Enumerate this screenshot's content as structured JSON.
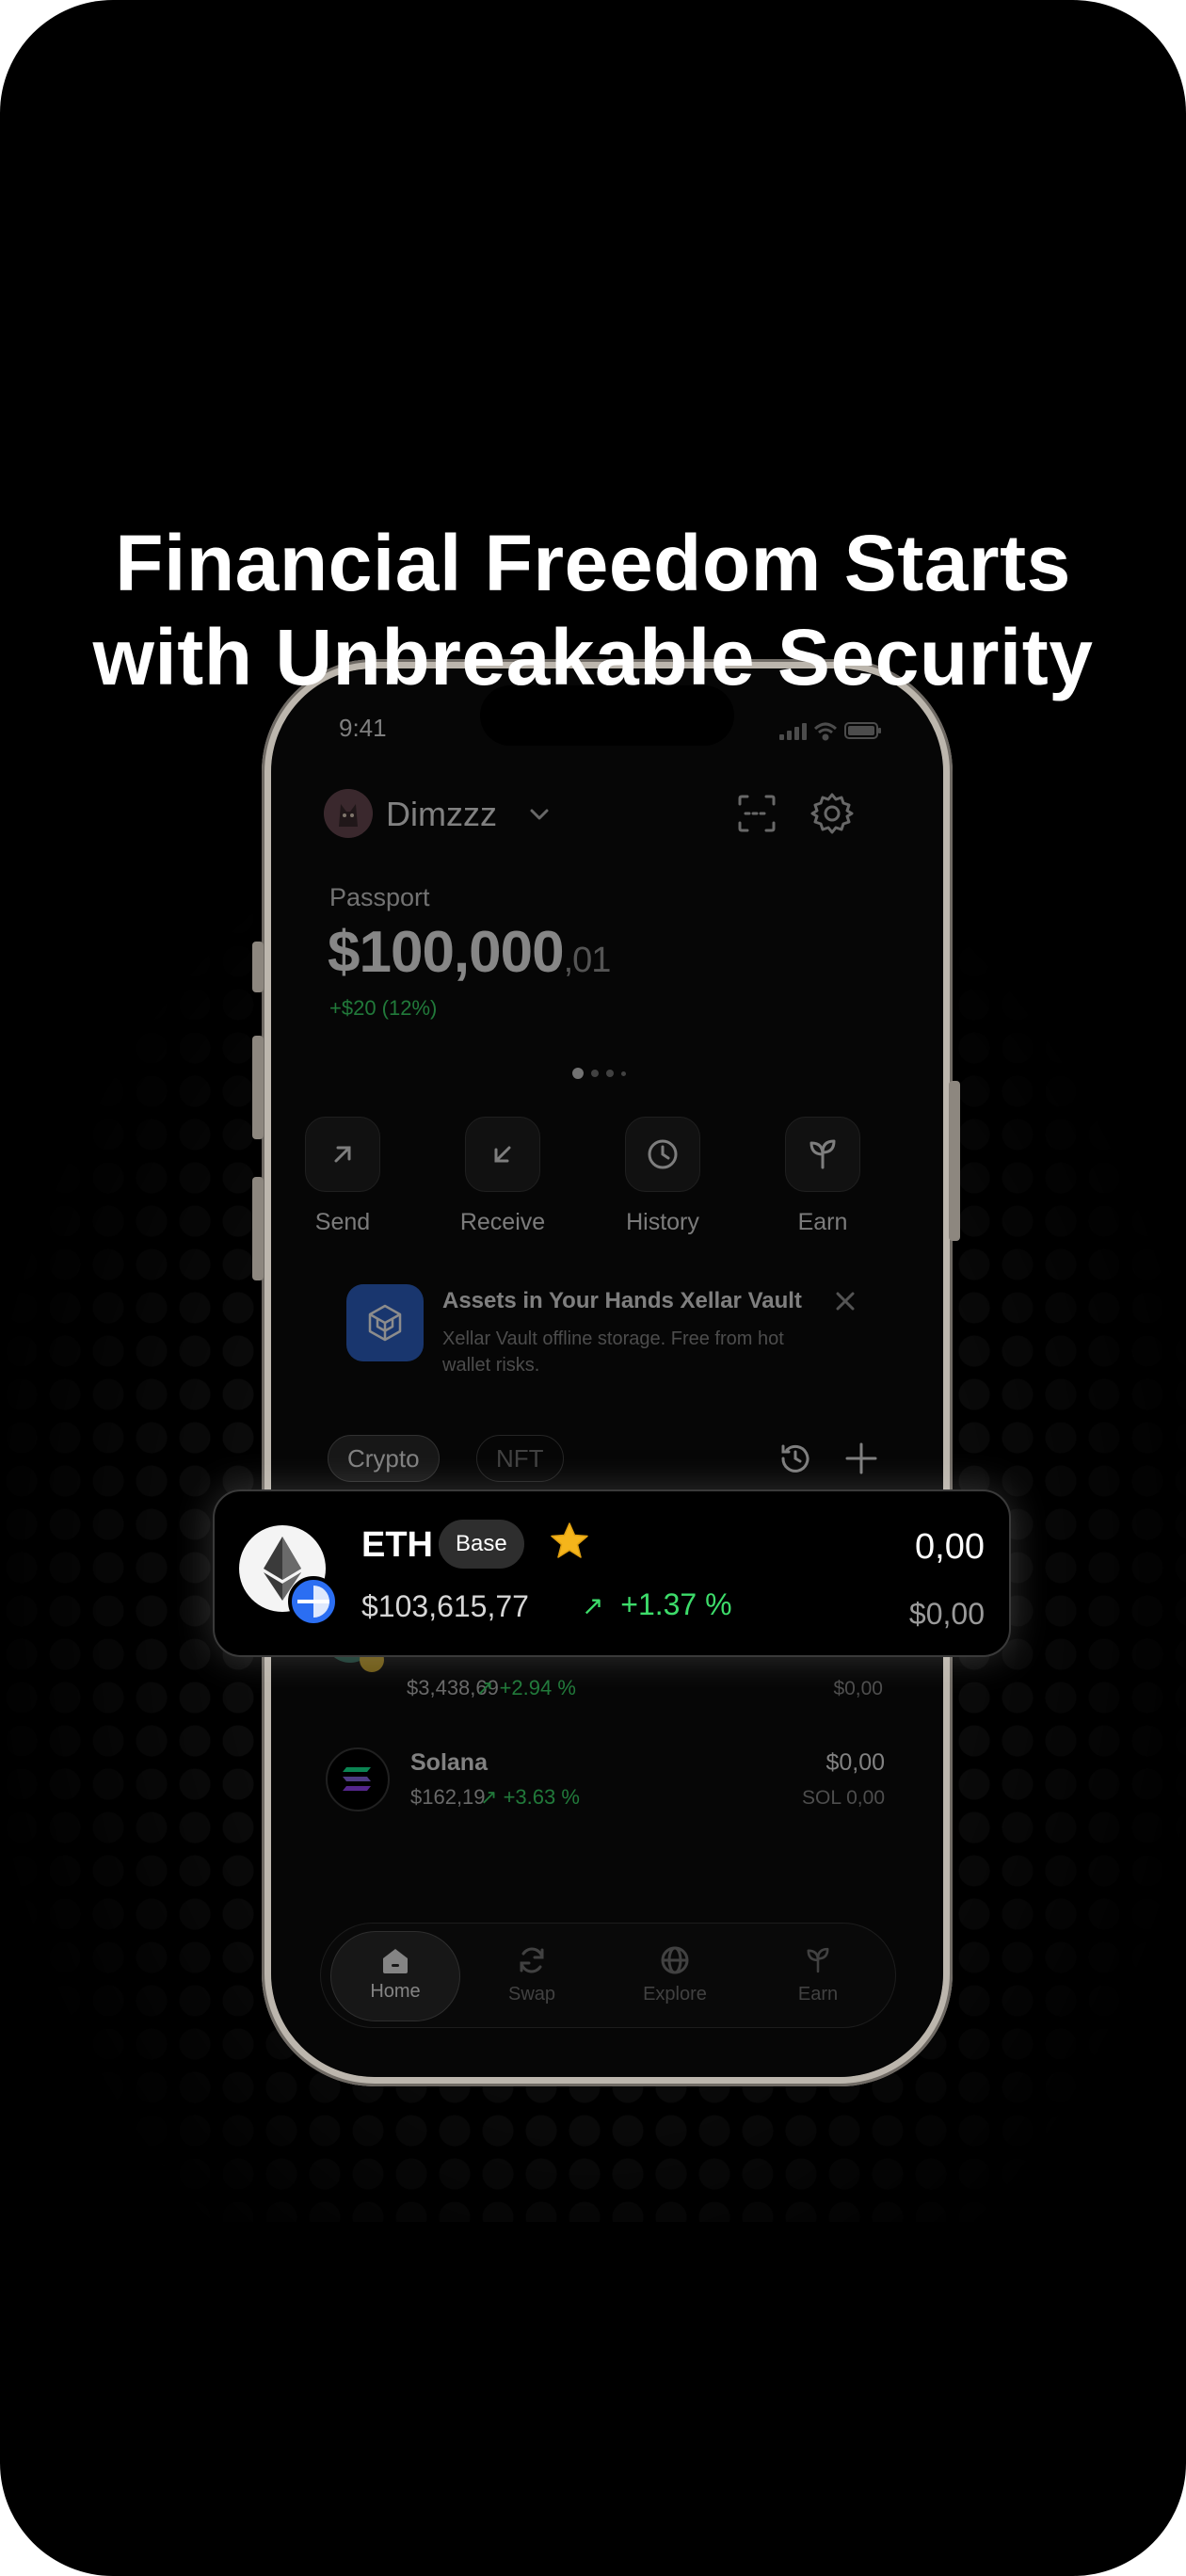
{
  "headline": {
    "line1": "Financial Freedom Starts",
    "line2": "with Unbreakable Security"
  },
  "status_bar": {
    "time": "9:41"
  },
  "header": {
    "username": "Dimzzz",
    "icons": [
      "avatar",
      "chevron-down-icon",
      "scan-icon",
      "settings-icon"
    ]
  },
  "wallet": {
    "label": "Passport",
    "balance_main": "$100,000",
    "balance_cents": ",01",
    "change": "+$20 (12%)"
  },
  "actions": [
    {
      "label": "Send",
      "icon": "arrow-up-right-icon"
    },
    {
      "label": "Receive",
      "icon": "arrow-down-left-icon"
    },
    {
      "label": "History",
      "icon": "clock-icon"
    },
    {
      "label": "Earn",
      "icon": "sprout-icon"
    }
  ],
  "banner": {
    "title": "Assets in Your Hands Xellar Vault",
    "description": "Xellar Vault offline storage. Free from hot wallet risks."
  },
  "filters": {
    "crypto": "Crypto",
    "nft": "NFT"
  },
  "assets": [
    {
      "name": "",
      "price": "$3,438,69",
      "change": "+2.94 %",
      "amount": "$0,00",
      "sub": "$0,00"
    },
    {
      "name": "Solana",
      "price": "$162,19",
      "change": "+3.63 %",
      "amount": "$0,00",
      "sub": "SOL 0,00"
    }
  ],
  "eth_card": {
    "symbol": "ETH",
    "badge": "Base",
    "price": "$103,615,77",
    "change": "+1.37 %",
    "amount": "0,00",
    "value": "$0,00",
    "star_color": "#f5b51b"
  },
  "tabbar": [
    {
      "label": "Home",
      "icon": "home-icon",
      "active": true
    },
    {
      "label": "Swap",
      "icon": "swap-icon",
      "active": false
    },
    {
      "label": "Explore",
      "icon": "globe-icon",
      "active": false
    },
    {
      "label": "Earn",
      "icon": "sprout-icon",
      "active": false
    }
  ],
  "colors": {
    "background": "#000000",
    "positive": "#3ddc6a",
    "vault_blue": "#2f63c8"
  }
}
